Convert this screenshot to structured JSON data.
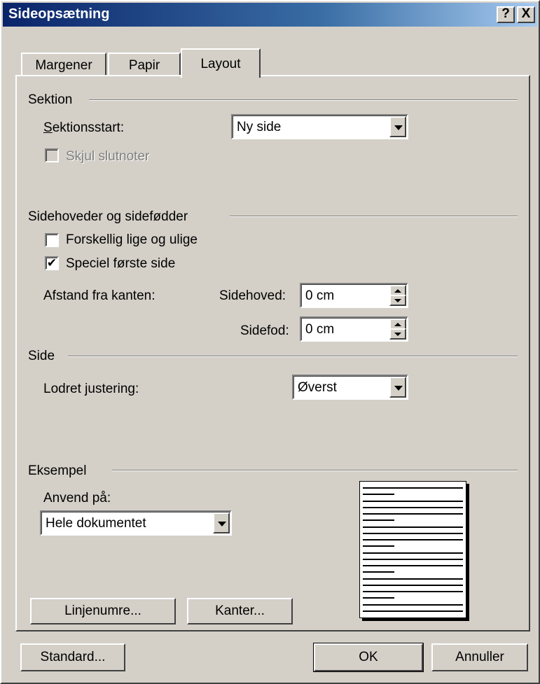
{
  "title": "Sideopsætning",
  "titlebar_buttons": {
    "help": "?",
    "close": "X"
  },
  "tabs": {
    "margins": "Margener",
    "paper": "Papir",
    "layout": "Layout"
  },
  "section": {
    "heading": "Sektion",
    "start_label": "Sektionsstart:",
    "start_value": "Ny side",
    "suppress_endnotes": "Skjul slutnoter"
  },
  "headers": {
    "heading": "Sidehoveder og sidefødder",
    "different_odd_even": "Forskellig lige og ulige",
    "different_first": "Speciel første side",
    "different_first_checked": "✔",
    "distance_label": "Afstand fra kanten:",
    "header_label": "Sidehoved:",
    "header_value": "0 cm",
    "footer_label": "Sidefod:",
    "footer_value": "0 cm"
  },
  "page": {
    "heading": "Side",
    "valign_label": "Lodret justering:",
    "valign_value": "Øverst"
  },
  "preview": {
    "heading": "Eksempel",
    "apply_label": "Anvend på:",
    "apply_value": "Hele dokumentet",
    "line_numbers": "Linjenumre...",
    "borders": "Kanter..."
  },
  "footer": {
    "default": "Standard...",
    "ok": "OK",
    "cancel": "Annuller"
  }
}
